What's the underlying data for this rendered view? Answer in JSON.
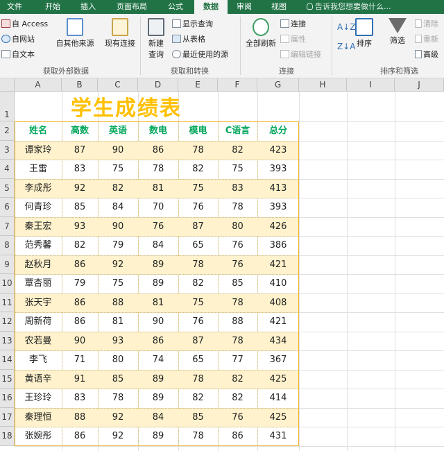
{
  "tabs": [
    "文件",
    "开始",
    "插入",
    "页面布局",
    "公式",
    "数据",
    "审阅",
    "视图"
  ],
  "active_tab": "数据",
  "tell_me": "告诉我您想要做什么...",
  "ribbon": {
    "get_external": {
      "from_access": "自 Access",
      "from_web": "自网站",
      "from_text": "自文本",
      "from_other": "自其他来源",
      "existing": "现有连接",
      "label": "获取外部数据"
    },
    "transform": {
      "new_query": "新建",
      "new_query_2": "查询",
      "show_queries": "显示查询",
      "from_table": "从表格",
      "recent": "最近使用的源",
      "label": "获取和转换"
    },
    "connections": {
      "refresh_all": "全部刷新",
      "connections": "连接",
      "properties": "属性",
      "edit_links": "编辑链接",
      "label": "连接"
    },
    "sort_filter": {
      "sort": "排序",
      "filter": "筛选",
      "clear": "清除",
      "reapply": "重新",
      "advanced": "高级",
      "label": "排序和筛选"
    }
  },
  "columns": [
    "A",
    "B",
    "C",
    "D",
    "E",
    "F",
    "G",
    "H",
    "I",
    "J"
  ],
  "rows": [
    "1",
    "2",
    "3",
    "4",
    "5",
    "6",
    "7",
    "8",
    "9",
    "10",
    "11",
    "12",
    "13",
    "14",
    "15",
    "16",
    "17",
    "18"
  ],
  "sheet": {
    "title": "学生成绩表",
    "headers": [
      "姓名",
      "高数",
      "英语",
      "数电",
      "模电",
      "C语言",
      "总分"
    ],
    "records": [
      [
        "谭家玲",
        "87",
        "90",
        "86",
        "78",
        "82",
        "423"
      ],
      [
        "王雷",
        "83",
        "75",
        "78",
        "82",
        "75",
        "393"
      ],
      [
        "李成彤",
        "92",
        "82",
        "81",
        "75",
        "83",
        "413"
      ],
      [
        "何青珍",
        "85",
        "84",
        "70",
        "76",
        "78",
        "393"
      ],
      [
        "秦王宏",
        "93",
        "90",
        "76",
        "87",
        "80",
        "426"
      ],
      [
        "范秀馨",
        "82",
        "79",
        "84",
        "65",
        "76",
        "386"
      ],
      [
        "赵秋月",
        "86",
        "92",
        "89",
        "78",
        "76",
        "421"
      ],
      [
        "覃杏丽",
        "79",
        "75",
        "89",
        "82",
        "85",
        "410"
      ],
      [
        "张天宇",
        "86",
        "88",
        "81",
        "75",
        "78",
        "408"
      ],
      [
        "周新荷",
        "86",
        "81",
        "90",
        "76",
        "88",
        "421"
      ],
      [
        "农若曼",
        "90",
        "93",
        "86",
        "87",
        "78",
        "434"
      ],
      [
        "李飞",
        "71",
        "80",
        "74",
        "65",
        "77",
        "367"
      ],
      [
        "黄语辛",
        "91",
        "85",
        "89",
        "78",
        "82",
        "425"
      ],
      [
        "王珍玲",
        "83",
        "78",
        "89",
        "82",
        "82",
        "414"
      ],
      [
        "秦理恒",
        "88",
        "92",
        "84",
        "85",
        "76",
        "425"
      ],
      [
        "张婉彤",
        "86",
        "92",
        "89",
        "78",
        "86",
        "431"
      ]
    ]
  },
  "colors": {
    "excel_green": "#217346",
    "title": "#ffc000",
    "header_text": "#00a65a",
    "band": "#fff2cc",
    "border": "#f0b323"
  }
}
